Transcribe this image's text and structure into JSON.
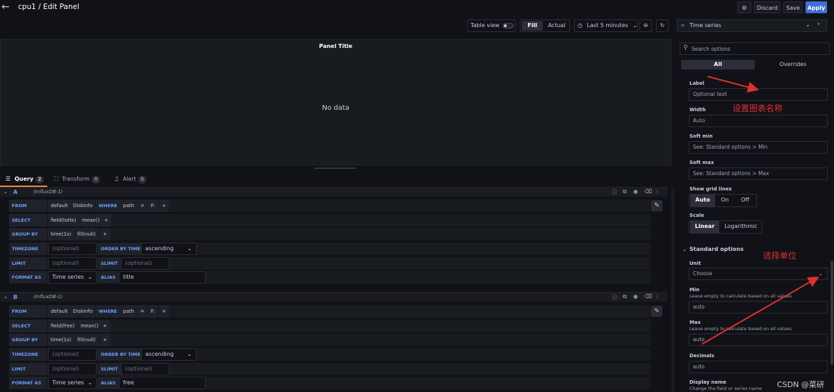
{
  "header": {
    "title": "cpu1 / Edit Panel",
    "settings_icon": "gear-icon",
    "discard": "Discard",
    "save": "Save",
    "apply": "Apply"
  },
  "toolbar": {
    "table_view": "Table view",
    "fill": "Fill",
    "actual": "Actual",
    "time_range": "Last 5 minutes"
  },
  "preview": {
    "panel_title": "Panel Title",
    "empty_text": "No data"
  },
  "tabs": [
    {
      "label": "Query",
      "count": "2"
    },
    {
      "label": "Transform",
      "count": "0"
    },
    {
      "label": "Alert",
      "count": "0"
    }
  ],
  "queries": [
    {
      "ref": "A",
      "datasource": "(InfluxDB-1)",
      "from": {
        "kw": "FROM",
        "policy": "default",
        "measurement": "DiskInfo",
        "where_kw": "WHERE",
        "tag": "path",
        "op": "=",
        "value": "F:"
      },
      "select": {
        "kw": "SELECT",
        "field": "field(totle)",
        "fn": "mean()"
      },
      "group_by": {
        "kw": "GROUP BY",
        "time": "time(1s)",
        "fill": "fill(null)"
      },
      "timezone": {
        "kw": "TIMEZONE",
        "placeholder": "(optional)",
        "order_kw": "ORDER BY TIME",
        "order": "ascending"
      },
      "limit": {
        "kw": "LIMIT",
        "placeholder": "(optional)",
        "slimit_kw": "SLIMIT",
        "slimit_placeholder": "(optional)"
      },
      "format": {
        "kw": "FORMAT AS",
        "value": "Time series",
        "alias_kw": "ALIAS",
        "alias": "title"
      }
    },
    {
      "ref": "B",
      "datasource": "(InfluxDB-1)",
      "from": {
        "kw": "FROM",
        "policy": "default",
        "measurement": "DiskInfo",
        "where_kw": "WHERE",
        "tag": "path",
        "op": "=",
        "value": "F:"
      },
      "select": {
        "kw": "SELECT",
        "field": "field(free)",
        "fn": "mean()"
      },
      "group_by": {
        "kw": "GROUP BY",
        "time": "time(1s)",
        "fill": "fill(null)"
      },
      "timezone": {
        "kw": "TIMEZONE",
        "placeholder": "(optional)",
        "order_kw": "ORDER BY TIME",
        "order": "ascending"
      },
      "limit": {
        "kw": "LIMIT",
        "placeholder": "(optional)",
        "slimit_kw": "SLIMIT",
        "slimit_placeholder": "(optional)"
      },
      "format": {
        "kw": "FORMAT AS",
        "value": "Time series",
        "alias_kw": "ALIAS",
        "alias": "free"
      }
    }
  ],
  "options": {
    "visualization": "Time series",
    "search_placeholder": "Search options",
    "tab_all": "All",
    "tab_overrides": "Overrides",
    "label": {
      "title": "Label",
      "placeholder": "Optional text"
    },
    "width": {
      "title": "Width",
      "value": "Auto"
    },
    "soft_min": {
      "title": "Soft min",
      "placeholder": "See: Standard options > Min"
    },
    "soft_max": {
      "title": "Soft max",
      "placeholder": "See: Standard options > Max"
    },
    "grid_lines": {
      "title": "Show grid lines",
      "auto": "Auto",
      "on": "On",
      "off": "Off"
    },
    "scale": {
      "title": "Scale",
      "linear": "Linear",
      "log": "Logarithmic"
    },
    "standard": {
      "title": "Standard options"
    },
    "unit": {
      "title": "Unit",
      "placeholder": "Choose"
    },
    "min": {
      "title": "Min",
      "desc": "Leave empty to calculate based on all values",
      "value": "auto"
    },
    "max": {
      "title": "Max",
      "desc": "Leave empty to calculate based on all values",
      "value": "auto"
    },
    "decimals": {
      "title": "Decimals",
      "value": "auto"
    },
    "display_name": {
      "title": "Display name",
      "desc": "Change the field or series name"
    }
  },
  "annotations": {
    "set_title": "设置图表名称",
    "choose_unit": "选择单位",
    "color": "#e02f2f"
  },
  "watermark": "CSDN @菜研"
}
